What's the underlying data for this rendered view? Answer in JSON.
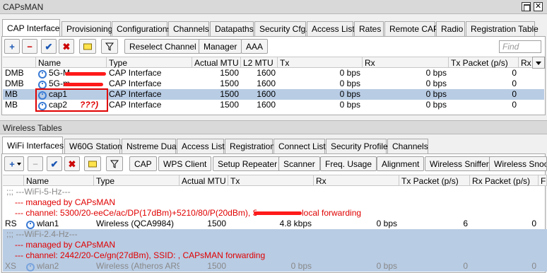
{
  "capsman": {
    "title": "CAPsMAN",
    "close_glyph": "✕",
    "tabs": [
      "CAP Interface",
      "Provisioning",
      "Configurations",
      "Channels",
      "Datapaths",
      "Security Cfg.",
      "Access List",
      "Rates",
      "Remote CAP",
      "Radio",
      "Registration Table"
    ],
    "toolbar": {
      "add": "+",
      "remove": "−",
      "enable": "✔",
      "disable": "✖",
      "comment": "",
      "filter": "",
      "reselect_channel": "Reselect Channel",
      "manager": "Manager",
      "aaa": "AAA",
      "find_placeholder": "Find"
    },
    "columns": [
      "",
      "Name",
      "Type",
      "Actual MTU",
      "L2 MTU",
      "Tx",
      "Rx",
      "Tx Packet (p/s)",
      "Rx"
    ],
    "rows": [
      {
        "flag": "DMB",
        "name": "5G-M",
        "type": "CAP Interface",
        "mtu": "1500",
        "l2mtu": "1600",
        "tx": "0 bps",
        "rx": "0 bps",
        "txp": "0",
        "selected": false
      },
      {
        "flag": "DMB",
        "name": "5G-m",
        "type": "CAP Interface",
        "mtu": "1500",
        "l2mtu": "1600",
        "tx": "0 bps",
        "rx": "0 bps",
        "txp": "0",
        "selected": false
      },
      {
        "flag": "MB",
        "name": "cap1",
        "type": "CAP Interface",
        "mtu": "1500",
        "l2mtu": "1600",
        "tx": "0 bps",
        "rx": "0 bps",
        "txp": "0",
        "selected": true
      },
      {
        "flag": "MB",
        "name": "cap2",
        "type": "CAP Interface",
        "mtu": "1500",
        "l2mtu": "1600",
        "tx": "0 bps",
        "rx": "0 bps",
        "txp": "0",
        "selected": false
      }
    ],
    "annotation": "???)"
  },
  "wireless": {
    "title": "Wireless Tables",
    "tabs": [
      "WiFi Interfaces",
      "W60G Station",
      "Nstreme Dual",
      "Access List",
      "Registration",
      "Connect List",
      "Security Profiles",
      "Channels"
    ],
    "toolbar": {
      "add": "+",
      "remove": "−",
      "enable": "✔",
      "disable": "✖",
      "cap": "CAP",
      "wps_client": "WPS Client",
      "setup_repeater": "Setup Repeater",
      "scanner": "Scanner",
      "freq_usage": "Freq. Usage",
      "alignment": "Alignment",
      "wireless_sniffer": "Wireless Sniffer",
      "wireless_snooper": "Wireless Snoop"
    },
    "columns": [
      "",
      "Name",
      "Type",
      "Actual MTU",
      "Tx",
      "Rx",
      "Tx Packet (p/s)",
      "Rx Packet (p/s)",
      "FI"
    ],
    "lines": {
      "c1": ";;; ---WiFi-5-Hz---",
      "c2": "--- managed by CAPsMAN",
      "c3a": "--- channel: 5300/20-eeCe/ac/DP(17dBm)+5210/80/P(20dBm), SSID: ",
      "c3b": "local forwarding",
      "r1_flag": "RS",
      "r1_name": "wlan1",
      "r1_type": "Wireless (QCA9984)",
      "r1_mtu": "1500",
      "r1_tx": "4.8 kbps",
      "r1_rx": "0 bps",
      "r1_txp": "6",
      "r1_rxp": "0",
      "c4": ";;; ---WiFi-2.4-Hz---",
      "c5": "--- managed by CAPsMAN",
      "c6": "--- channel: 2442/20-Ce/gn(27dBm), SSID: , CAPsMAN forwarding",
      "r2_flag": "XS",
      "r2_name": "wlan2",
      "r2_type": "Wireless (Atheros AR9...",
      "r2_mtu": "1500",
      "r2_tx": "0 bps",
      "r2_rx": "0 bps",
      "r2_txp": "0",
      "r2_rxp": "0"
    }
  }
}
